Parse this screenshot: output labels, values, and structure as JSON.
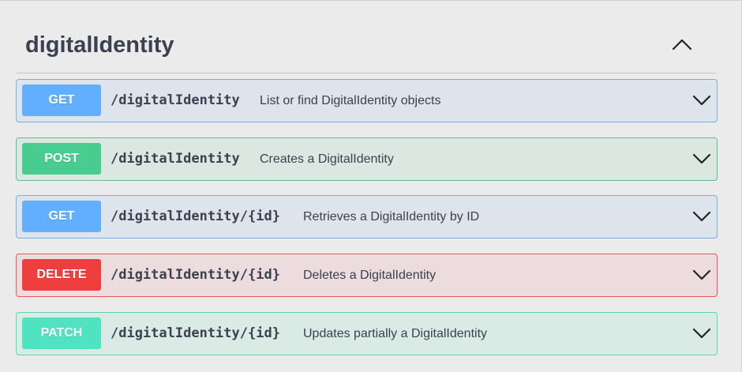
{
  "section": {
    "title": "digitalIdentity",
    "collapse_icon": "chevron-up-icon"
  },
  "operations": [
    {
      "method": "GET",
      "path": "/digitalIdentity",
      "summary": "List or find DigitalIdentity objects",
      "color": "#61affe",
      "expand_icon": "chevron-down-icon"
    },
    {
      "method": "POST",
      "path": "/digitalIdentity",
      "summary": "Creates a DigitalIdentity",
      "color": "#49cc90",
      "expand_icon": "chevron-down-icon"
    },
    {
      "method": "GET",
      "path": "/digitalIdentity/{id}",
      "summary": "Retrieves a DigitalIdentity by ID",
      "color": "#61affe",
      "expand_icon": "chevron-down-icon"
    },
    {
      "method": "DELETE",
      "path": "/digitalIdentity/{id}",
      "summary": "Deletes a DigitalIdentity",
      "color": "#ef3e3e",
      "expand_icon": "chevron-down-icon"
    },
    {
      "method": "PATCH",
      "path": "/digitalIdentity/{id}",
      "summary": "Updates partially a DigitalIdentity",
      "color": "#50e3c2",
      "expand_icon": "chevron-down-icon"
    }
  ]
}
